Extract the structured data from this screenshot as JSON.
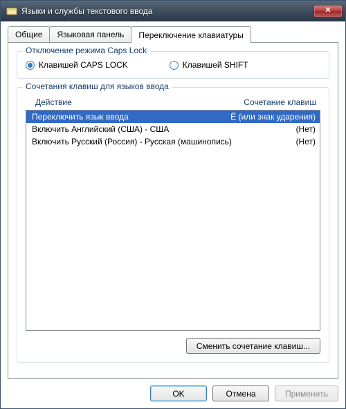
{
  "window": {
    "title": "Языки и службы текстового ввода",
    "close_label": "✕"
  },
  "tabs": [
    {
      "label": "Общие",
      "active": false
    },
    {
      "label": "Языковая панель",
      "active": false
    },
    {
      "label": "Переключение клавиатуры",
      "active": true
    }
  ],
  "caps_group": {
    "legend": "Отключение режима Caps Lock",
    "options": [
      {
        "label": "Клавишей CAPS LOCK",
        "checked": true
      },
      {
        "label": "Клавишей SHIFT",
        "checked": false
      }
    ]
  },
  "hotkeys_group": {
    "legend": "Сочетания клавиш для языков ввода",
    "columns": {
      "action": "Действие",
      "combo": "Сочетание клавиш"
    },
    "rows": [
      {
        "action": "Переключить язык ввода",
        "combo": "Ё (или знак ударения)",
        "selected": true
      },
      {
        "action": "Включить Английский (США) - США",
        "combo": "(Нет)",
        "selected": false
      },
      {
        "action": "Включить Русский (Россия) - Русская (машинопись)",
        "combo": "(Нет)",
        "selected": false
      }
    ],
    "change_button": "Сменить сочетание клавиш..."
  },
  "footer": {
    "ok": "OK",
    "cancel": "Отмена",
    "apply": "Применить"
  }
}
